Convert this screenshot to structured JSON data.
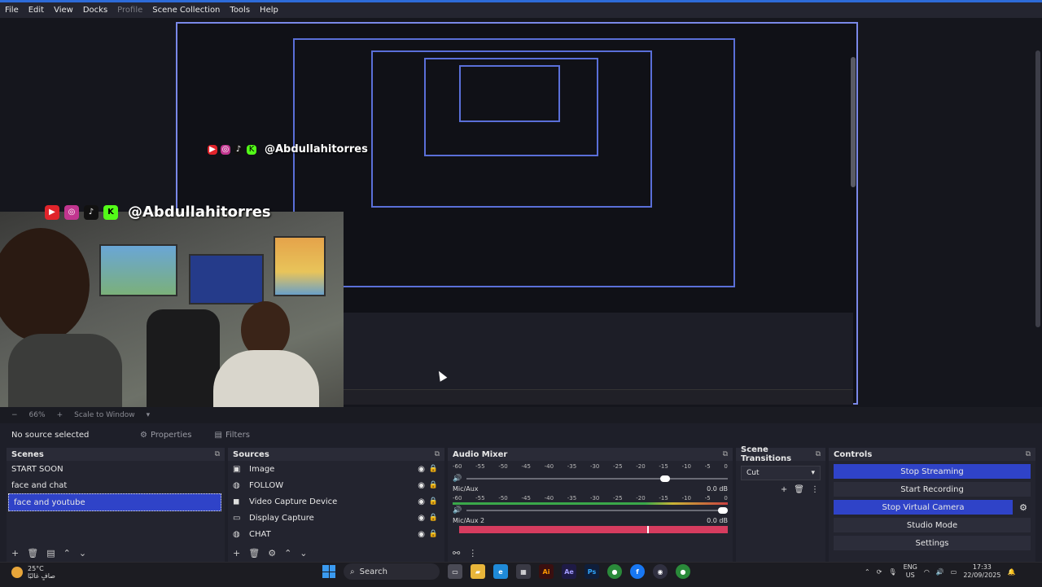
{
  "menu": {
    "items": [
      "File",
      "Edit",
      "View",
      "Docks",
      "Profile",
      "Scene Collection",
      "Tools",
      "Help"
    ]
  },
  "overlay": {
    "handle": "@Abdullahitorres",
    "social_icons": [
      "youtube-icon",
      "instagram-icon",
      "tiktok-icon",
      "kick-icon"
    ]
  },
  "status": {
    "zoom": "66%",
    "scale_mode": "Scale to Window"
  },
  "properties_bar": {
    "no_source": "No source selected",
    "properties_label": "Properties",
    "filters_label": "Filters"
  },
  "scenes": {
    "title": "Scenes",
    "items": [
      "START SOON",
      "face and chat",
      "face and youtube"
    ],
    "selected_index": 2
  },
  "sources": {
    "title": "Sources",
    "items": [
      {
        "name": "Image",
        "icon": "image-icon"
      },
      {
        "name": "FOLLOW",
        "icon": "browser-icon"
      },
      {
        "name": "Video Capture Device",
        "icon": "camera-icon"
      },
      {
        "name": "Display Capture",
        "icon": "display-icon"
      },
      {
        "name": "CHAT",
        "icon": "browser-icon"
      }
    ]
  },
  "audio_mixer": {
    "title": "Audio Mixer",
    "ticks": [
      "-60",
      "-55",
      "-50",
      "-45",
      "-40",
      "-35",
      "-30",
      "-25",
      "-20",
      "-15",
      "-10",
      "-5",
      "0"
    ],
    "channels": [
      {
        "name": "",
        "db": "",
        "volume": 0.78
      },
      {
        "name": "Mic/Aux",
        "db": "0.0 dB",
        "volume": 1.0
      },
      {
        "name": "Mic/Aux 2",
        "db": "0.0 dB",
        "volume": 0.7
      }
    ]
  },
  "transitions": {
    "title": "Scene Transitions",
    "selected": "Cut"
  },
  "controls": {
    "title": "Controls",
    "stop_streaming": "Stop Streaming",
    "start_recording": "Start Recording",
    "stop_virtual_camera": "Stop Virtual Camera",
    "studio_mode": "Studio Mode",
    "settings": "Settings"
  },
  "taskbar": {
    "temperature": "25°C",
    "weather_text": "صافٍ غالبًا",
    "search": "Search",
    "lang_top": "ENG",
    "lang_bottom": "US",
    "time": "17:33",
    "date": "22/09/2025"
  },
  "colors": {
    "accent": "#2f43c8",
    "meter_red": "#d63c5f"
  }
}
